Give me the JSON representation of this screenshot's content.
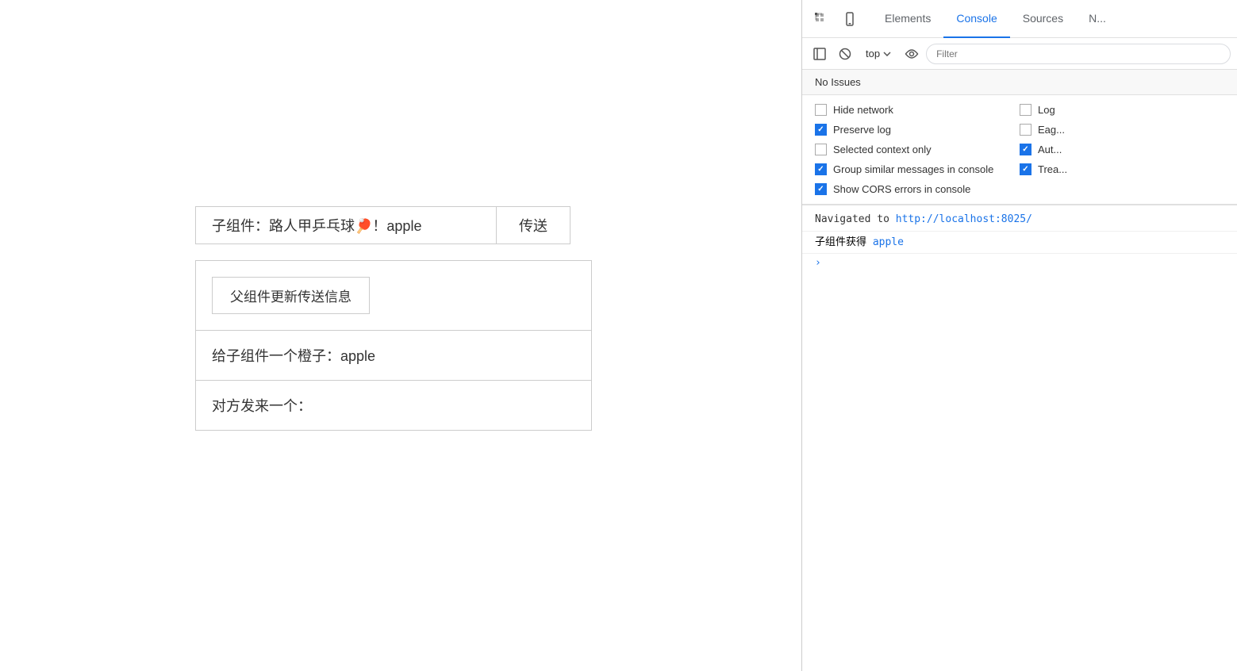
{
  "webpage": {
    "child_component": {
      "label": "子组件：路人甲乒乓球",
      "emoji": "🏓",
      "suffix": "！apple",
      "send_button": "传送"
    },
    "parent_component": {
      "update_button": "父组件更新传送信息",
      "orange_label": "给子组件一个橙子：apple",
      "received_label": "对方发来一个："
    }
  },
  "devtools": {
    "tabs": [
      {
        "id": "elements",
        "label": "Elements"
      },
      {
        "id": "console",
        "label": "Console"
      },
      {
        "id": "sources",
        "label": "Sources"
      },
      {
        "id": "network",
        "label": "N..."
      }
    ],
    "active_tab": "console",
    "secondary_toolbar": {
      "top_label": "top",
      "filter_placeholder": "Filter"
    },
    "no_issues": "No Issues",
    "options": [
      {
        "id": "hide-network",
        "label": "Hide network",
        "checked": false,
        "col": 0
      },
      {
        "id": "log",
        "label": "Log",
        "checked": false,
        "col": 1
      },
      {
        "id": "preserve-log",
        "label": "Preserve log",
        "checked": true,
        "col": 0
      },
      {
        "id": "eag",
        "label": "Eag...",
        "checked": false,
        "col": 1
      },
      {
        "id": "selected-context",
        "label": "Selected context only",
        "checked": false,
        "col": 0
      },
      {
        "id": "aut",
        "label": "Aut...",
        "checked": true,
        "col": 1
      },
      {
        "id": "group-similar",
        "label": "Group similar messages in console",
        "checked": true,
        "col": 0
      },
      {
        "id": "trea",
        "label": "Trea...",
        "checked": true,
        "col": 1
      },
      {
        "id": "show-cors",
        "label": "Show CORS errors in console",
        "checked": true,
        "col": 0
      }
    ],
    "console_entries": [
      {
        "type": "navigated",
        "text_prefix": "Navigated to ",
        "link": "http://localhost:8025/",
        "link_text": "http://localhost:8025/"
      },
      {
        "type": "log",
        "text": "子组件获得",
        "value": "apple"
      }
    ]
  }
}
